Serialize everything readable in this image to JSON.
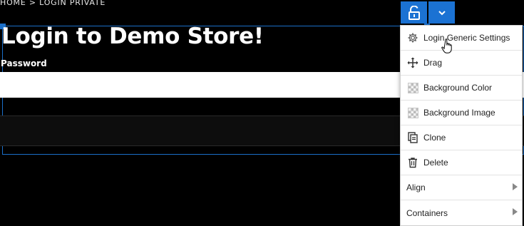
{
  "breadcrumb": "HOME > LOGIN PRIVATE",
  "page": {
    "title": "Login to Demo Store!",
    "password_label": "Password",
    "password_value": ""
  },
  "toolbar": {
    "unlock_icon": "unlock-icon",
    "dropdown_icon": "chevron-down-icon",
    "accent_color": "#1b72d3"
  },
  "menu": {
    "items": [
      {
        "label": "Login Generic Settings",
        "icon": "gear-icon"
      },
      {
        "label": "Drag",
        "icon": "move-icon"
      },
      {
        "label": "Background Color",
        "icon": "checker-icon"
      },
      {
        "label": "Background Image",
        "icon": "checker-icon"
      },
      {
        "label": "Clone",
        "icon": "clone-icon"
      },
      {
        "label": "Delete",
        "icon": "trash-icon"
      },
      {
        "label": "Align",
        "icon": "submenu-arrow-icon"
      },
      {
        "label": "Containers",
        "icon": "submenu-arrow-icon"
      }
    ]
  }
}
